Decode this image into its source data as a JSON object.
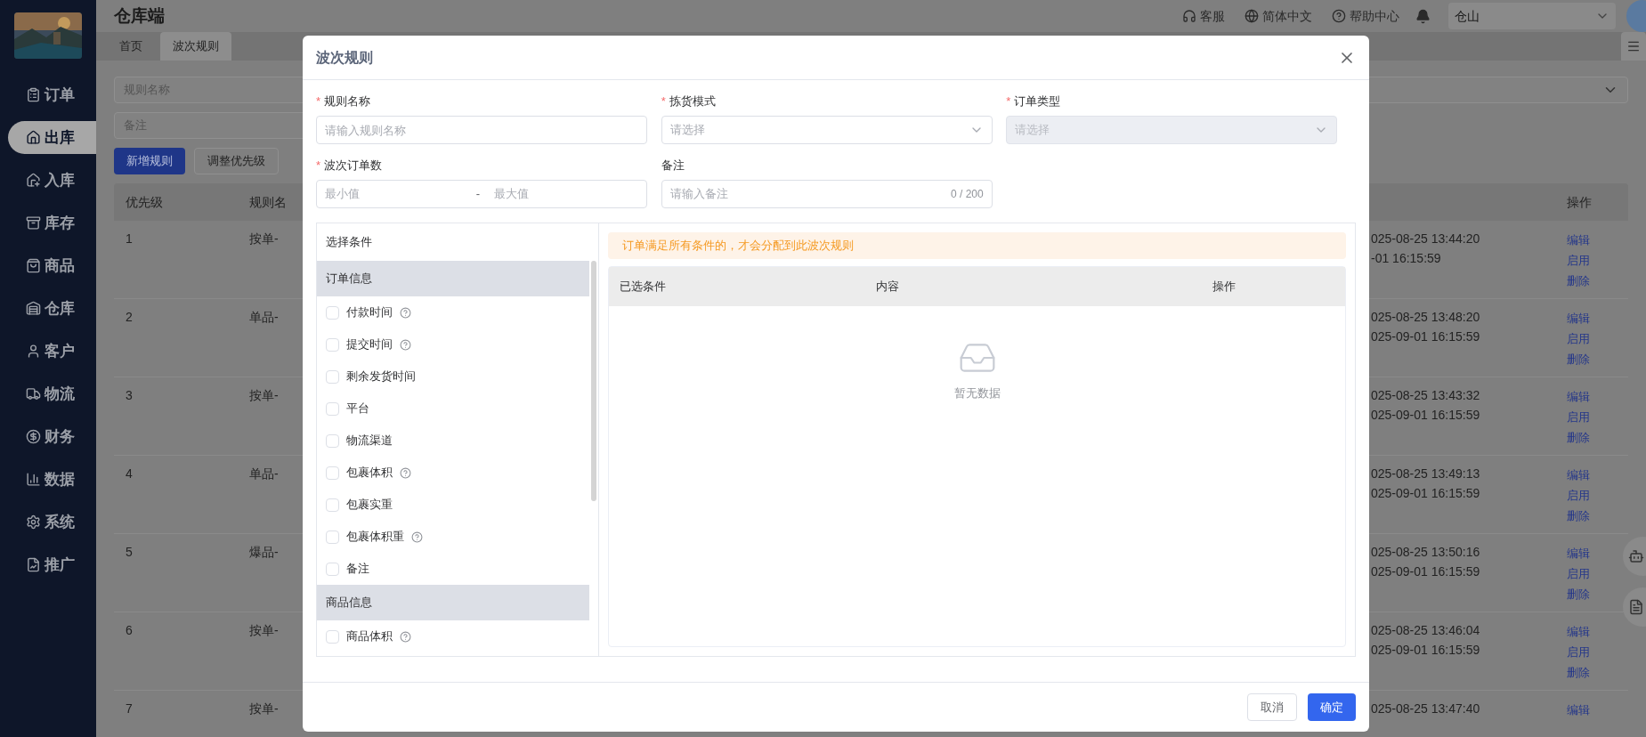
{
  "header": {
    "title": "仓库端",
    "links": [
      "客服",
      "简体中文",
      "帮助中心"
    ],
    "warehouse_select": {
      "value": "仓山"
    }
  },
  "sidebar": {
    "items": [
      {
        "label": "订单",
        "selected": false
      },
      {
        "label": "出库",
        "selected": true
      },
      {
        "label": "入库",
        "selected": false
      },
      {
        "label": "库存",
        "selected": false
      },
      {
        "label": "商品",
        "selected": false
      },
      {
        "label": "仓库",
        "selected": false
      },
      {
        "label": "客户",
        "selected": false
      },
      {
        "label": "物流",
        "selected": false
      },
      {
        "label": "财务",
        "selected": false
      },
      {
        "label": "数据",
        "selected": false
      },
      {
        "label": "系统",
        "selected": false
      },
      {
        "label": "推广",
        "selected": false
      }
    ]
  },
  "tabs": [
    {
      "label": "首页",
      "selected": false
    },
    {
      "label": "波次规则",
      "selected": true
    }
  ],
  "filters": {
    "name": {
      "placeholder": "规则名称"
    },
    "remark": {
      "placeholder": "备注"
    }
  },
  "actions": [
    {
      "label": "新增规则",
      "primary": true
    },
    {
      "label": "调整优先级",
      "primary": false
    }
  ],
  "table": {
    "columns": [
      "优先级",
      "规则名",
      "操作"
    ],
    "rows": [
      {
        "priority": "1",
        "name": "按单-",
        "time_1": "025-08-25 13:44:20",
        "time_2": "-01 16:15:59",
        "actions": [
          "编辑",
          "启用",
          "删除"
        ]
      },
      {
        "priority": "2",
        "name": "单品-",
        "time_1": "025-08-25 13:48:20",
        "time_2": "025-09-01 16:15:59",
        "actions": [
          "编辑",
          "启用",
          "删除"
        ]
      },
      {
        "priority": "3",
        "name": "按单-",
        "time_1": "025-08-25 13:43:32",
        "time_2": "025-09-01 16:15:59",
        "actions": [
          "编辑",
          "启用",
          "删除"
        ]
      },
      {
        "priority": "4",
        "name": "单品-",
        "time_1": "025-08-25 13:49:13",
        "time_2": "025-09-01 16:15:59",
        "actions": [
          "编辑",
          "启用",
          "删除"
        ]
      },
      {
        "priority": "5",
        "name": "爆品-",
        "time_1": "025-08-25 13:50:16",
        "time_2": "025-09-01 16:15:59",
        "actions": [
          "编辑",
          "启用",
          "删除"
        ]
      },
      {
        "priority": "6",
        "name": "按单-",
        "time_1": "025-08-25 13:46:04",
        "time_2": "025-09-01 16:15:59",
        "actions": [
          "编辑",
          "启用",
          "删除"
        ]
      },
      {
        "priority": "7",
        "name": "按单-",
        "time_1": "025-08-25 13:47:40",
        "actions": [
          "编辑"
        ]
      }
    ]
  },
  "dialog": {
    "title": "波次规则",
    "required_mark": "*",
    "fields": [
      {
        "label": "规则名称",
        "required": true,
        "kind": "input",
        "placeholder": "请输入规则名称",
        "disabled": false
      },
      {
        "label": "拣货模式",
        "required": true,
        "kind": "select",
        "placeholder": "请选择",
        "disabled": false
      },
      {
        "label": "订单类型",
        "required": true,
        "kind": "select",
        "placeholder": "请选择",
        "disabled": true
      },
      {
        "label": "波次订单数",
        "required": true,
        "kind": "range",
        "placeholder": "最小值",
        "placeholder_2": "最大值",
        "separator": "-",
        "disabled": false
      },
      {
        "label": "备注",
        "required": false,
        "kind": "counter",
        "placeholder": "请输入备注",
        "counter": "0 / 200",
        "disabled": false
      }
    ],
    "conditions": {
      "title": "选择条件",
      "groups": [
        {
          "label": "订单信息",
          "items": [
            {
              "label": "付款时间",
              "checked": false,
              "help": true
            },
            {
              "label": "提交时间",
              "checked": false,
              "help": true
            },
            {
              "label": "剩余发货时间",
              "checked": false,
              "help": false
            },
            {
              "label": "平台",
              "checked": false,
              "help": false
            },
            {
              "label": "物流渠道",
              "checked": false,
              "help": false
            },
            {
              "label": "包裹体积",
              "checked": false,
              "help": true
            },
            {
              "label": "包裹实重",
              "checked": false,
              "help": false
            },
            {
              "label": "包裹体积重",
              "checked": false,
              "help": true
            },
            {
              "label": "备注",
              "checked": false,
              "help": false
            }
          ]
        },
        {
          "label": "商品信息",
          "items": [
            {
              "label": "商品体积",
              "checked": false,
              "help": true
            }
          ]
        }
      ]
    },
    "notice": "订单满足所有条件的，才会分配到此波次规则",
    "selected_table": {
      "columns": [
        "已选条件",
        "内容",
        "操作"
      ],
      "empty_text": "暂无数据"
    },
    "buttons": [
      {
        "label": "取消",
        "primary": false
      },
      {
        "label": "确定",
        "primary": true
      }
    ]
  }
}
